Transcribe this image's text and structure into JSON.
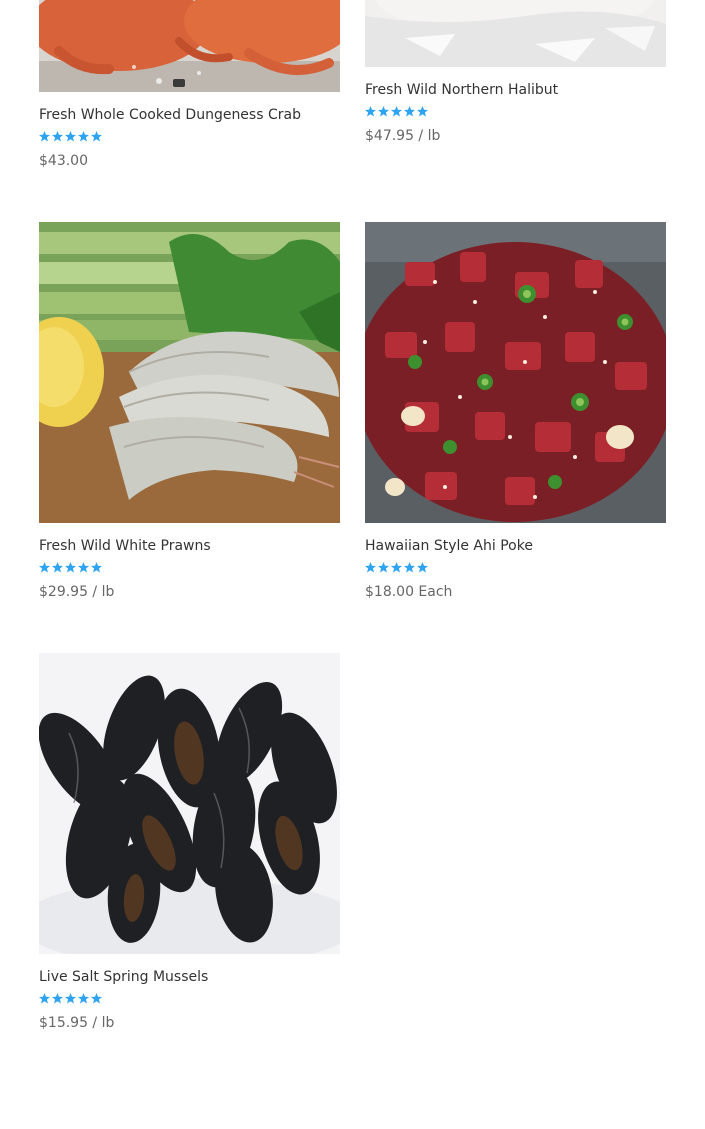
{
  "products": [
    {
      "name": "Fresh Whole Cooked Dungeness Crab",
      "price": "$43.00",
      "image_subject": "cooked dungeness crab on tray"
    },
    {
      "name": "Fresh Wild Northern Halibut",
      "price": "$47.95 / lb",
      "image_subject": "halibut fillet on ice"
    },
    {
      "name": "Fresh Wild White Prawns",
      "price": "$29.95 / lb",
      "image_subject": "raw prawns with celery and lemon"
    },
    {
      "name": "Hawaiian Style Ahi Poke",
      "price": "$18.00 Each",
      "image_subject": "ahi poke with green onion and sesame"
    },
    {
      "name": "Live Salt Spring Mussels",
      "price": "$15.95 / lb",
      "image_subject": "live mussels on ice"
    }
  ],
  "rating": {
    "value": 5,
    "max": 5
  },
  "colors": {
    "star": "#2ea3f2",
    "title": "#333333",
    "price": "#666666"
  }
}
